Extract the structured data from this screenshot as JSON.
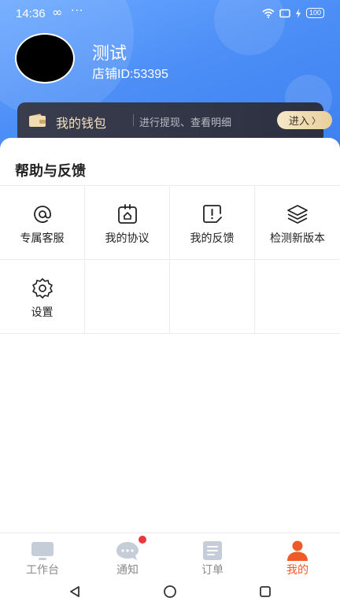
{
  "status_bar": {
    "time": "14:36",
    "infinity": "∞",
    "dots": "···",
    "battery": "100"
  },
  "profile": {
    "name": "测试",
    "store_id": "店铺ID:53395"
  },
  "wallet": {
    "title": "我的钱包",
    "subtitle": "进行提现、查看明细",
    "enter_label": "进入",
    "enter_arrow": "〉"
  },
  "help": {
    "title": "帮助与反馈",
    "items": [
      {
        "label": "专属客服",
        "icon": "at-icon"
      },
      {
        "label": "我的协议",
        "icon": "agreement-icon"
      },
      {
        "label": "我的反馈",
        "icon": "feedback-icon"
      },
      {
        "label": "检测新版本",
        "icon": "layers-icon"
      },
      {
        "label": "设置",
        "icon": "gear-icon"
      }
    ]
  },
  "tabbar": {
    "items": [
      {
        "label": "工作台",
        "icon": "workbench-icon",
        "active": false
      },
      {
        "label": "通知",
        "icon": "notification-icon",
        "active": false,
        "badge": true
      },
      {
        "label": "订单",
        "icon": "order-icon",
        "active": false
      },
      {
        "label": "我的",
        "icon": "profile-icon",
        "active": true
      }
    ]
  },
  "colors": {
    "accent": "#f05a28",
    "header_blue": "#4d8ff7",
    "wallet_gold": "#e8cf9c"
  }
}
